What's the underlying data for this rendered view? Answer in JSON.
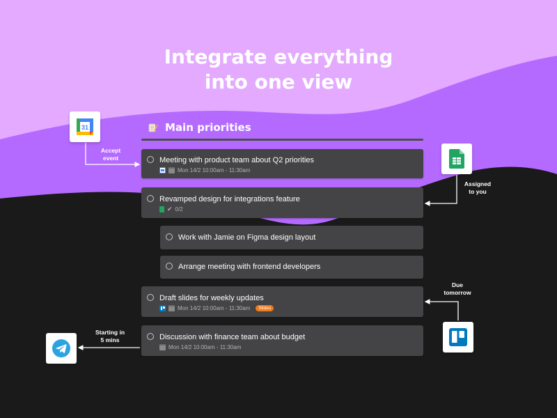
{
  "headline": {
    "line1": "Integrate everything",
    "line2": "into one view"
  },
  "section": {
    "title": "Main priorities",
    "icon": "memo-pencil-icon"
  },
  "tasks": [
    {
      "title": "Meeting with product team about Q2 priorities",
      "meta": "Mon 14/2 10:00am - 11:30am",
      "integration": "google-calendar-icon"
    },
    {
      "title": "Revamped design for integrations feature",
      "meta": "0/2",
      "integration": "google-sheets-icon"
    },
    {
      "title": "Work with Jamie on Figma design layout"
    },
    {
      "title": "Arrange meeting with frontend developers"
    },
    {
      "title": "Draft slides for weekly updates",
      "meta": "Mon 14/2 10:00am - 11:30am",
      "badge": "Slides",
      "integration": "trello-icon"
    },
    {
      "title": "Discussion with finance team about budget",
      "meta": "Mon 14/2 10:00am - 11:30am"
    }
  ],
  "callouts": {
    "calendar": {
      "line1": "Accept",
      "line2": "event",
      "icon": "google-calendar-icon",
      "icon_text": "31"
    },
    "sheets": {
      "line1": "Assigned",
      "line2": "to you",
      "icon": "google-sheets-icon"
    },
    "trello": {
      "line1": "Due",
      "line2": "tomorrow",
      "icon": "trello-icon"
    },
    "telegram": {
      "line1": "Starting in",
      "line2": "5 mins",
      "icon": "telegram-icon"
    }
  },
  "colors": {
    "purple_light": "#e3aaff",
    "purple_mid": "#b56aff",
    "purple_deep": "#9b4dff",
    "dark": "#1a1a1a",
    "card": "#444446",
    "badge": "#f07b1c",
    "sheets_green": "#21a464",
    "trello_blue": "#0079bf",
    "telegram_blue": "#2aa3e0"
  }
}
